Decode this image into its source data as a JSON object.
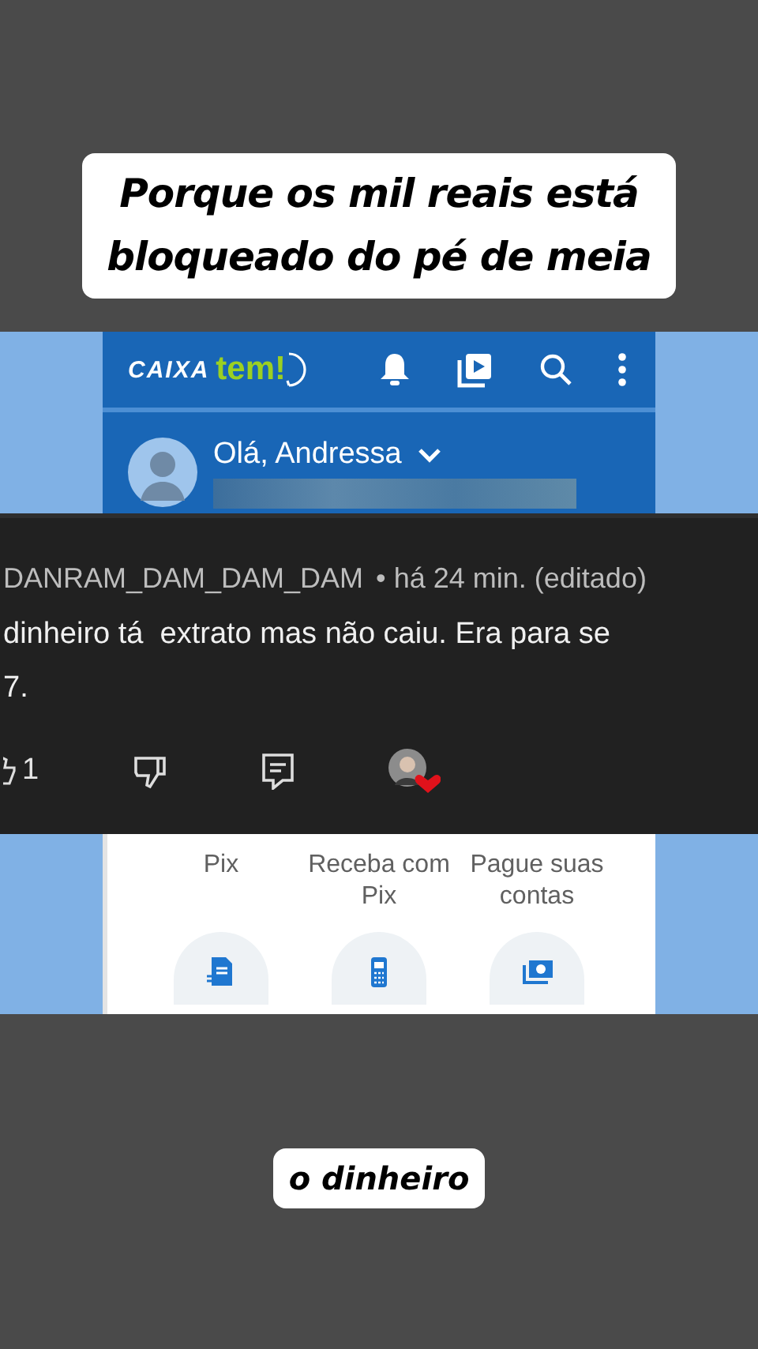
{
  "captions": {
    "top_lines": [
      "Porque os mil reais está",
      "bloqueado do pé de meia"
    ],
    "bottom": "o dinheiro"
  },
  "app": {
    "logo": {
      "brand": "CAIXA",
      "product": "tem!"
    },
    "greeting": "Olá, Andressa",
    "shortcuts": [
      {
        "label": "Pix"
      },
      {
        "label": "Receba com Pix"
      },
      {
        "label": "Pague suas contas"
      }
    ]
  },
  "comment": {
    "author": "DANRAM_DAM_DAM_DAM",
    "meta": "• há 24 min. (editado)",
    "text_lines": [
      "dinheiro tá  extrato mas não caiu. Era para se",
      "7."
    ],
    "likes": "1"
  }
}
